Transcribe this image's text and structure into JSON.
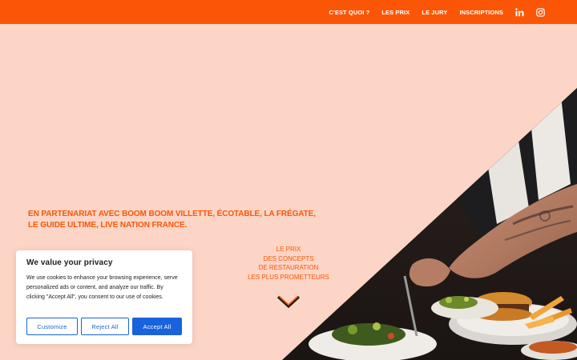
{
  "nav": {
    "items": [
      {
        "label": "C'EST QUOI ?"
      },
      {
        "label": "LES PRIX"
      },
      {
        "label": "LE JURY"
      },
      {
        "label": "INSCRIPTIONS"
      }
    ],
    "icons": [
      "linkedin-icon",
      "instagram-icon"
    ]
  },
  "hero": {
    "partner_line1": "EN PARTENARIAT AVEC BOOM BOOM VILLETTE, ÉCOTABLE, LA FRÉGATE,",
    "partner_line2": "LE GUIDE ULTIME, LIVE NATION FRANCE.",
    "tagline": [
      "LE PRIX",
      "DES CONCEPTS",
      "DE RESTAURATION",
      "LES PLUS PROMETTEURS"
    ]
  },
  "cookie": {
    "title": "We value your privacy",
    "text": "We use cookies to enhance your browsing experience, serve personalized ads or content, and analyze our traffic. By clicking \"Accept All\", you consent to our use of cookies.",
    "customize_label": "Customize",
    "reject_label": "Reject All",
    "accept_label": "Accept All"
  },
  "colors": {
    "brand_orange": "#fb5607",
    "background_peach": "#fdd5c6",
    "cookie_blue": "#1863dc"
  }
}
